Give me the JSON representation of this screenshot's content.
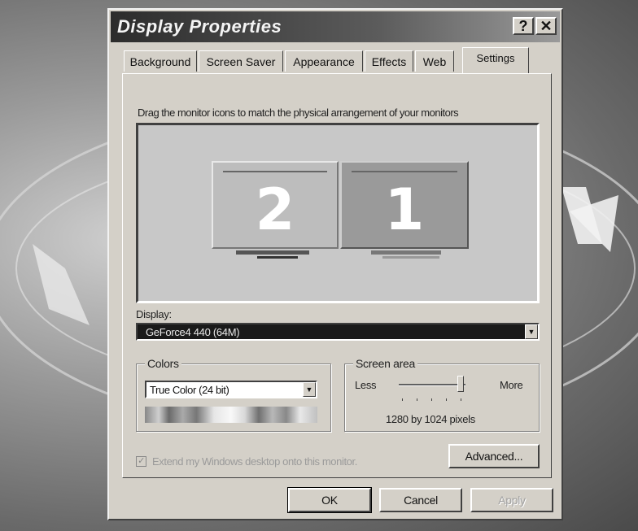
{
  "window": {
    "title": "Display Properties",
    "help_label": "?",
    "close_label": "✕"
  },
  "tabs": [
    {
      "label": "Background"
    },
    {
      "label": "Screen Saver"
    },
    {
      "label": "Appearance"
    },
    {
      "label": "Effects"
    },
    {
      "label": "Web"
    },
    {
      "label": "Settings",
      "active": true
    }
  ],
  "settings": {
    "instruction": "Drag the monitor icons to match the physical arrangement of your monitors",
    "monitors": [
      {
        "number": "2",
        "color": "#bdbdbd"
      },
      {
        "number": "1",
        "color": "#9a9a9a"
      }
    ],
    "display_label": "Display:",
    "display_value": "GeForce4 440 (64M)",
    "colors_label": "Colors",
    "colors_value": "True Color (24 bit)",
    "screen_area_label": "Screen area",
    "less_label": "Less",
    "more_label": "More",
    "resolution_text": "1280 by 1024 pixels",
    "extend_label": "Extend my Windows desktop onto this monitor.",
    "extend_checked": true,
    "advanced_label": "Advanced..."
  },
  "buttons": {
    "ok": "OK",
    "cancel": "Cancel",
    "apply": "Apply"
  },
  "dropdown_arrow": "▼",
  "check_mark": "✓"
}
